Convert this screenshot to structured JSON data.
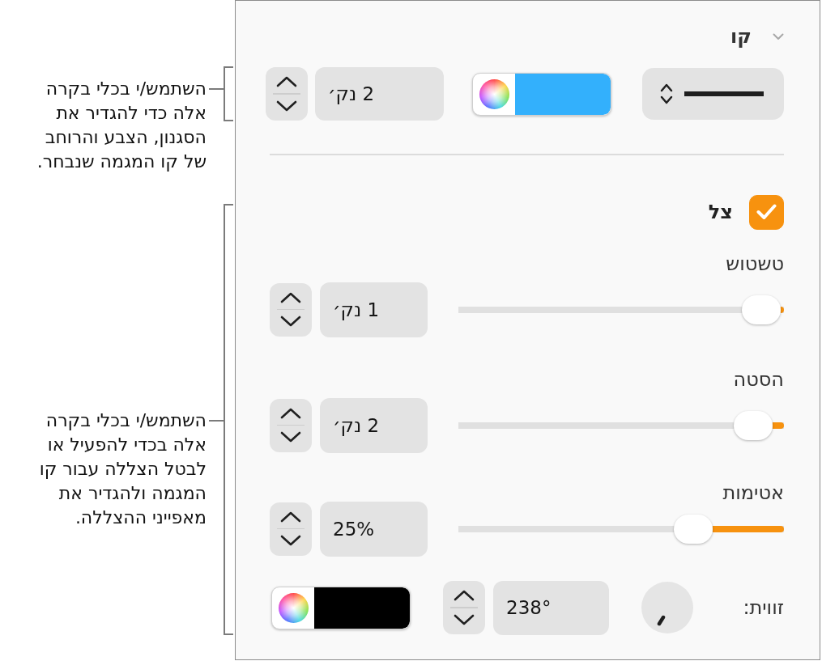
{
  "callouts": [
    {
      "text": "השתמש/י בכלי בקרה אלה כדי להגדיר את הסגנון, הצבע והרוחב של קו המגמה שנבחר."
    },
    {
      "text": "השתמש/י בכלי בקרה אלה בכדי להפעיל או לבטל הצללה עבור קו המגמה ולהגדיר את מאפייני ההצללה."
    }
  ],
  "panel": {
    "section": {
      "title": "קו",
      "expanded": true
    },
    "line": {
      "color": "#33b0fc",
      "width": "2 נק׳"
    },
    "shadow": {
      "label": "צל",
      "checked": true,
      "sliders": [
        {
          "label": "טשטוש",
          "level": 0.01,
          "value": "1 נק׳"
        },
        {
          "label": "הסטה",
          "level": 0.04,
          "value": "2 נק׳"
        },
        {
          "label": "אטימות",
          "level": 0.25,
          "value": "25%"
        }
      ],
      "angle": {
        "label": "זווית:",
        "value": "238°"
      },
      "color": "#000000"
    }
  }
}
